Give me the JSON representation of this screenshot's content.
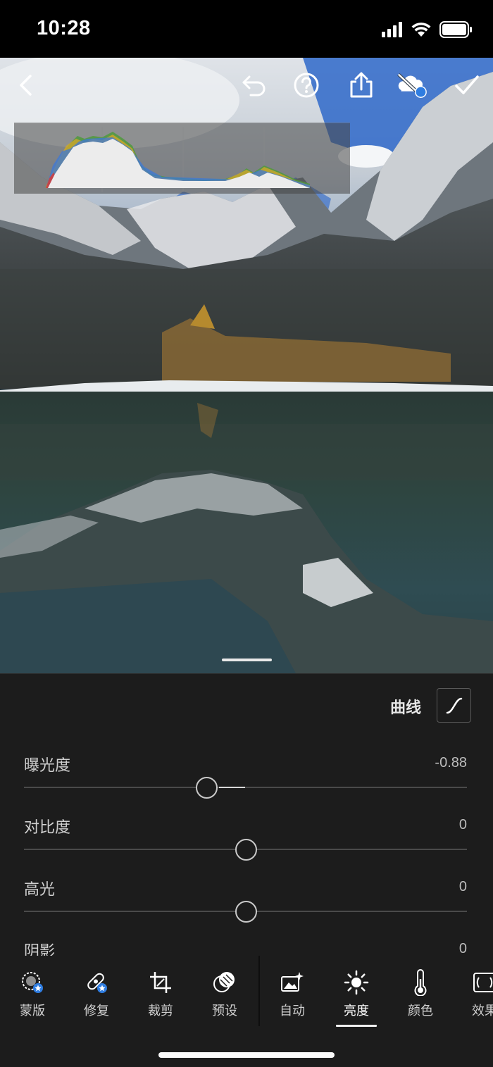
{
  "status_bar": {
    "time": "10:28"
  },
  "toolbar": {
    "icons": [
      "back-icon",
      "undo-icon",
      "help-icon",
      "share-icon",
      "cloud-sync-icon",
      "checkmark-icon"
    ]
  },
  "panel": {
    "curve_label": "曲线",
    "sliders": [
      {
        "label": "曝光度",
        "value": "-0.88",
        "level": -0.88
      },
      {
        "label": "对比度",
        "value": "0",
        "level": 0
      },
      {
        "label": "高光",
        "value": "0",
        "level": 0
      },
      {
        "label": "阴影",
        "value": "0",
        "level": 0
      }
    ]
  },
  "tabs": [
    {
      "label": "蒙版",
      "icon": "mask-icon"
    },
    {
      "label": "修复",
      "icon": "heal-icon"
    },
    {
      "label": "裁剪",
      "icon": "crop-icon"
    },
    {
      "label": "预设",
      "icon": "preset-icon"
    },
    {
      "label": "自动",
      "icon": "auto-icon"
    },
    {
      "label": "亮度",
      "icon": "sun-icon",
      "active": true
    },
    {
      "label": "颜色",
      "icon": "thermometer-icon"
    },
    {
      "label": "效果",
      "icon": "effects-icon"
    }
  ],
  "colors": {
    "panel_bg": "#1c1c1c",
    "accent_blue": "#2f7de1"
  }
}
